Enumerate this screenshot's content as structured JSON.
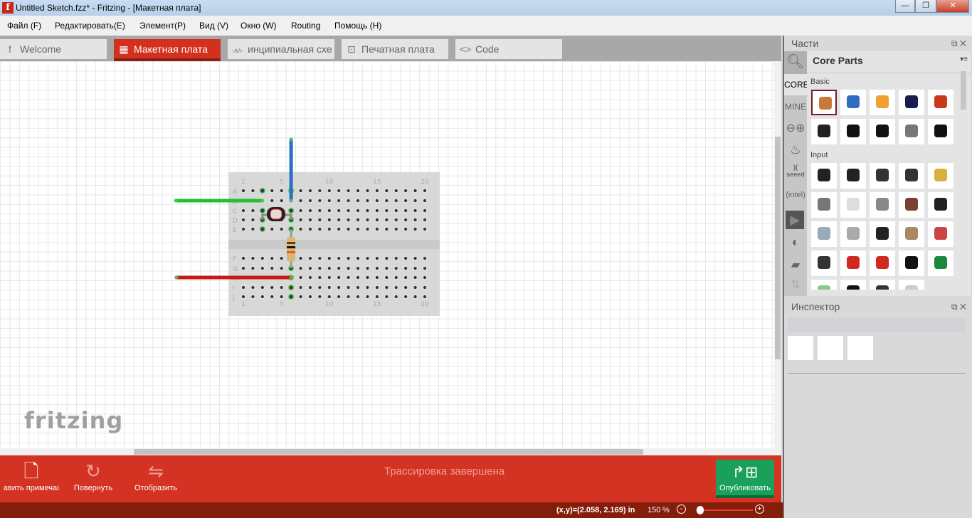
{
  "window": {
    "title": "Untitled Sketch.fzz* - Fritzing - [Макетная плата]",
    "app_icon": "f"
  },
  "menu": [
    "Файл (F)",
    "Редактировать(E)",
    "Элемент(P)",
    "Вид (V)",
    "Окно (W)",
    "Routing",
    "Помощь (H)"
  ],
  "tabs": [
    {
      "label": "Welcome",
      "icon": "fritzing-f-icon",
      "glyph": "f"
    },
    {
      "label": "Макетная плата",
      "icon": "breadboard-icon",
      "glyph": "▦",
      "active": true
    },
    {
      "label": "инципиальная схе",
      "icon": "schematic-resistor-icon",
      "glyph": "-ᴧᴧ-"
    },
    {
      "label": "Печатная плата",
      "icon": "pcb-icon",
      "glyph": "⊡"
    },
    {
      "label": "Code",
      "icon": "code-icon",
      "glyph": "<>"
    }
  ],
  "canvas": {
    "logo": "fritzing",
    "breadboard": {
      "columns": [
        "1",
        "5",
        "10",
        "15",
        "20"
      ],
      "rows_top": [
        "A",
        "B",
        "C",
        "D",
        "E"
      ],
      "rows_bottom": [
        "F",
        "G",
        "H",
        "I",
        "J"
      ]
    },
    "wires": [
      {
        "color": "#22c035"
      },
      {
        "color": "#2a70c8"
      },
      {
        "color": "#c81a14"
      }
    ]
  },
  "toolbar": {
    "note": "авить примечаı",
    "rotate": "Повернуть",
    "flip": "Отобразить",
    "status": "Трассировка завершена",
    "publish": "Опубликовать"
  },
  "status": {
    "coords": "(x,y)=(2.058, 2.169) in",
    "zoom": "150",
    "zoom_unit": "%",
    "zoom_level": 0.05
  },
  "parts": {
    "title": "Части",
    "bin_title": "Core Parts",
    "bins": [
      "CORE",
      "MINE"
    ],
    "sections": [
      {
        "label": "Basic"
      },
      {
        "label": "Input"
      }
    ]
  },
  "inspector": {
    "title": "Инспектор"
  },
  "colors": {
    "accent": "#d43323",
    "status_bar": "#841e0b",
    "publish": "#1aa05a"
  }
}
